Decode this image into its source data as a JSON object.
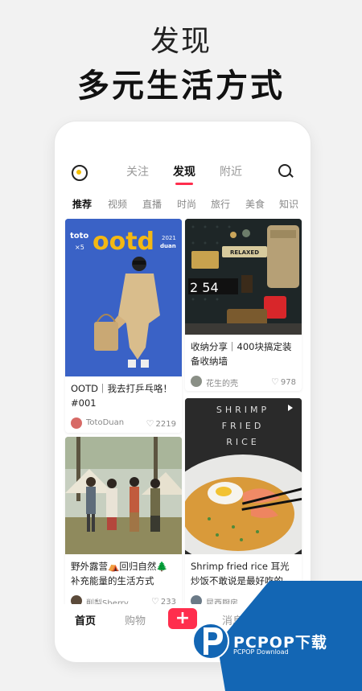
{
  "hero": {
    "line1": "发现",
    "line2": "多元生活方式"
  },
  "header": {
    "tabs": [
      {
        "label": "关注",
        "active": false
      },
      {
        "label": "发现",
        "active": true
      },
      {
        "label": "附近",
        "active": false
      }
    ]
  },
  "categories": [
    "推荐",
    "视频",
    "直播",
    "时尚",
    "旅行",
    "美食",
    "知识"
  ],
  "cards": [
    {
      "title": "OOTD｜我去打乒乓咯！#001",
      "author": "TotoDuan",
      "likes": "2219",
      "image_text": "toto ×5 ootd 2021 duan"
    },
    {
      "title": "收纳分享｜400块搞定装备收纳墙",
      "author": "花生的壳",
      "likes": "978",
      "image_text": "RELAXED",
      "clock": "2  54"
    },
    {
      "title": "野外露营⛺回归自然🌲补充能量的生活方式",
      "author": "削梨Sherry",
      "likes": "233"
    },
    {
      "title": "Shrimp fried rice 耳光炒饭不敢说是最好吃的",
      "author": "昆西厨房",
      "likes": "",
      "image_text": "SHRIMP FRIED RICE"
    }
  ],
  "bottom_nav": {
    "home": "首页",
    "shop": "购物",
    "add": "+",
    "messages": "消息"
  },
  "watermark": {
    "brand": "PCPOP下载",
    "sub": "PCPOP Download"
  },
  "colors": {
    "accent": "#ff2e4d",
    "watermark_blue": "#1366b4"
  }
}
